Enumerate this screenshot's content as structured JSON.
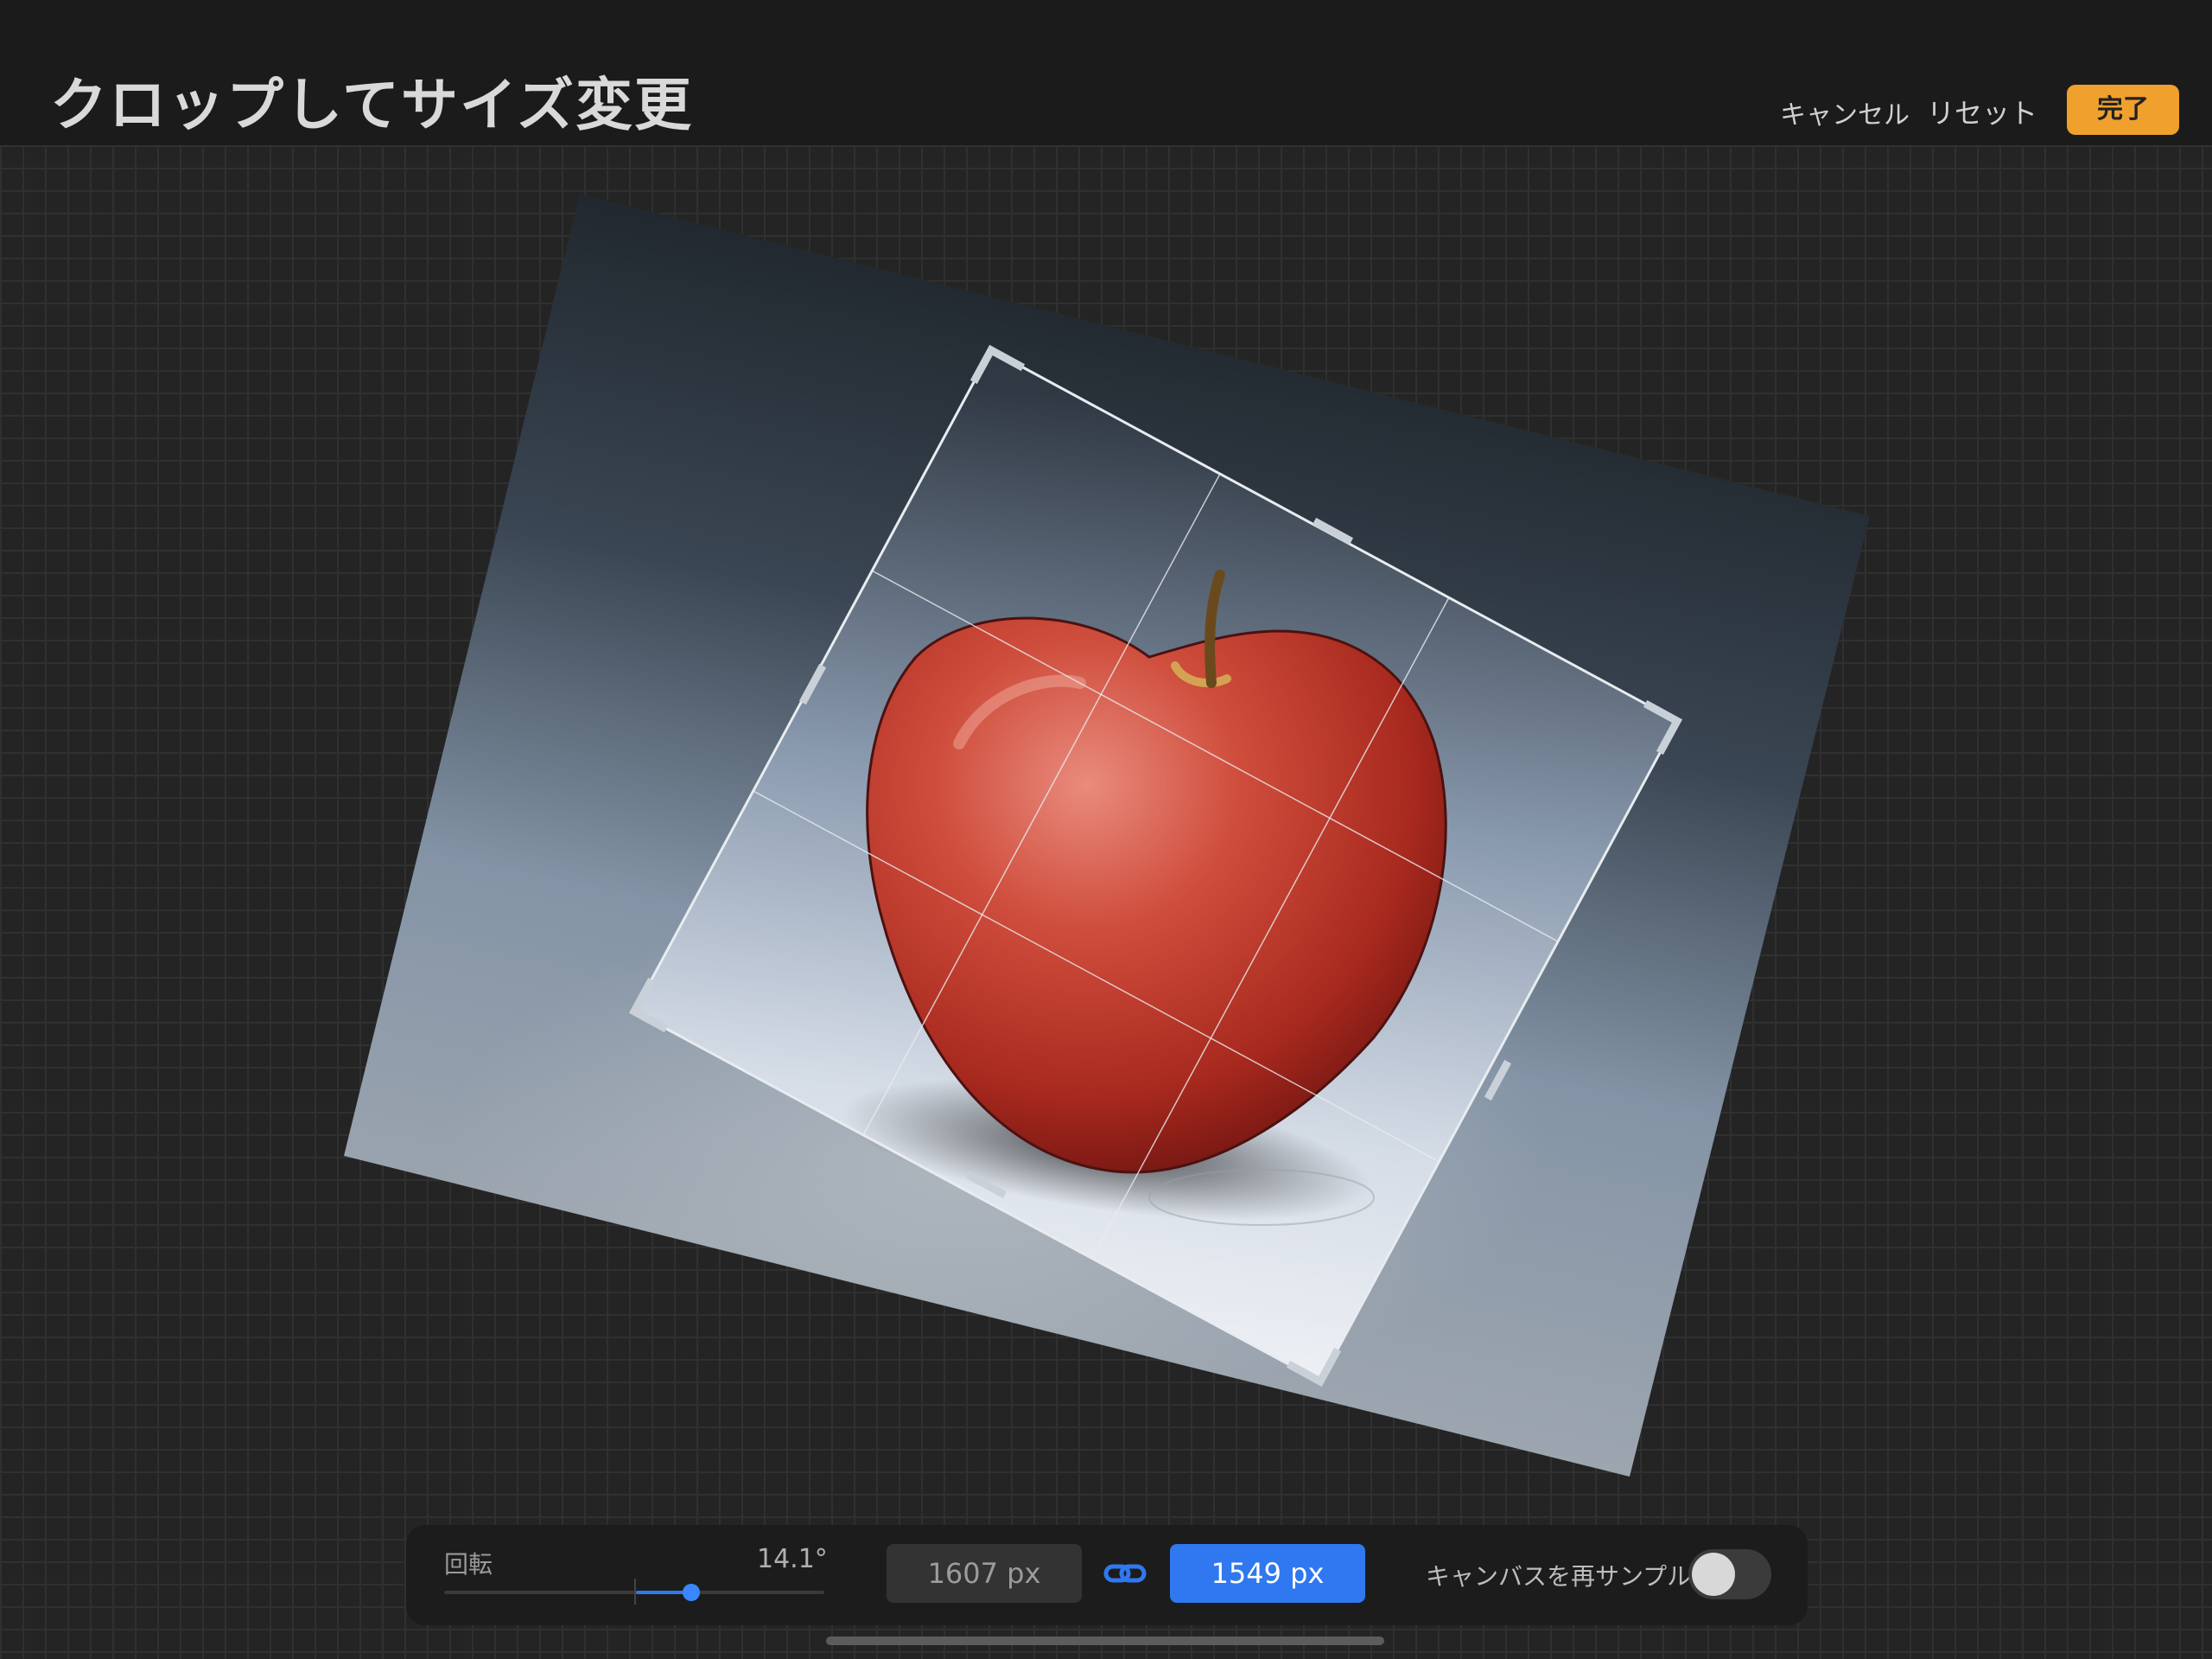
{
  "header": {
    "title": "クロップしてサイズ変更",
    "cancel_label": "キャンセル",
    "reset_label": "リセット",
    "done_label": "完了"
  },
  "rotation": {
    "label": "回転",
    "value": "14.1°",
    "degrees": 14.1
  },
  "size": {
    "width": "1607 px",
    "height": "1549 px"
  },
  "link_icon": "chain-link-icon",
  "resample": {
    "label": "キャンバスを再サンプル",
    "enabled": false
  },
  "colors": {
    "accent_orange": "#f0a02c",
    "accent_blue": "#2f78f0"
  }
}
